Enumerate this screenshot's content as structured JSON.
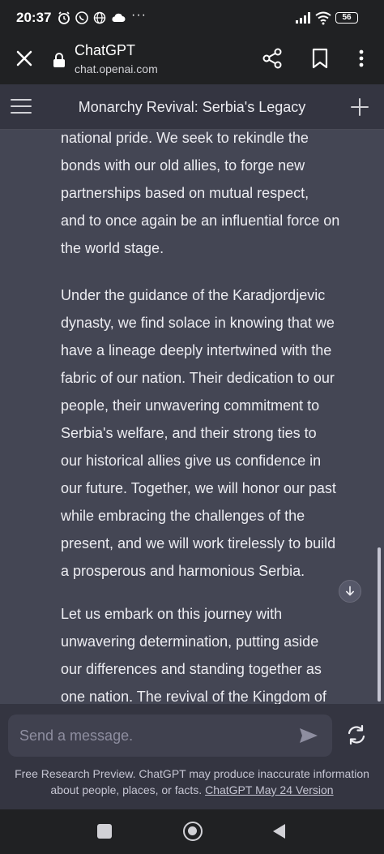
{
  "status_bar": {
    "time": "20:37",
    "battery": "56",
    "icons": [
      "alarm-icon",
      "whatsapp-icon",
      "globe-icon",
      "cloud-icon",
      "more-icon",
      "signal-icon",
      "wifi-icon",
      "battery-icon"
    ],
    "more": "···"
  },
  "browser": {
    "title": "ChatGPT",
    "url": "chat.openai.com"
  },
  "app_header": {
    "title": "Monarchy Revival: Serbia's Legacy"
  },
  "message": {
    "paragraph_1": [
      "national pride. We seek to rekindle the",
      "bonds with our old allies, to forge new",
      "partnerships based on mutual respect,",
      "and to once again be an influential force on",
      "the world stage."
    ],
    "paragraph_2": [
      "Under the guidance of the Karadjordjevic",
      "dynasty, we find solace in knowing that we",
      "have a lineage deeply intertwined with the",
      "fabric of our nation. Their dedication to our",
      "people, their unwavering commitment to",
      "Serbia's welfare, and their strong ties to",
      "our historical allies give us confidence in",
      "our future. Together, we will honor our past",
      "while embracing the challenges of the",
      "present, and we will work tirelessly to build",
      "a prosperous and harmonious Serbia."
    ],
    "paragraph_3": [
      "Let us embark on this journey with",
      "unwavering determination, putting aside",
      "our differences and standing together as",
      "one nation. The revival of the Kingdom of"
    ]
  },
  "composer": {
    "placeholder": "Send a message."
  },
  "footer": {
    "text": "Free Research Preview. ChatGPT may produce inaccurate information about people, places, or facts.",
    "link": "ChatGPT May 24 Version"
  },
  "colors": {
    "background": "#343541",
    "message_bg": "#444654",
    "bar_bg": "#202123",
    "input_bg": "#40414f"
  }
}
